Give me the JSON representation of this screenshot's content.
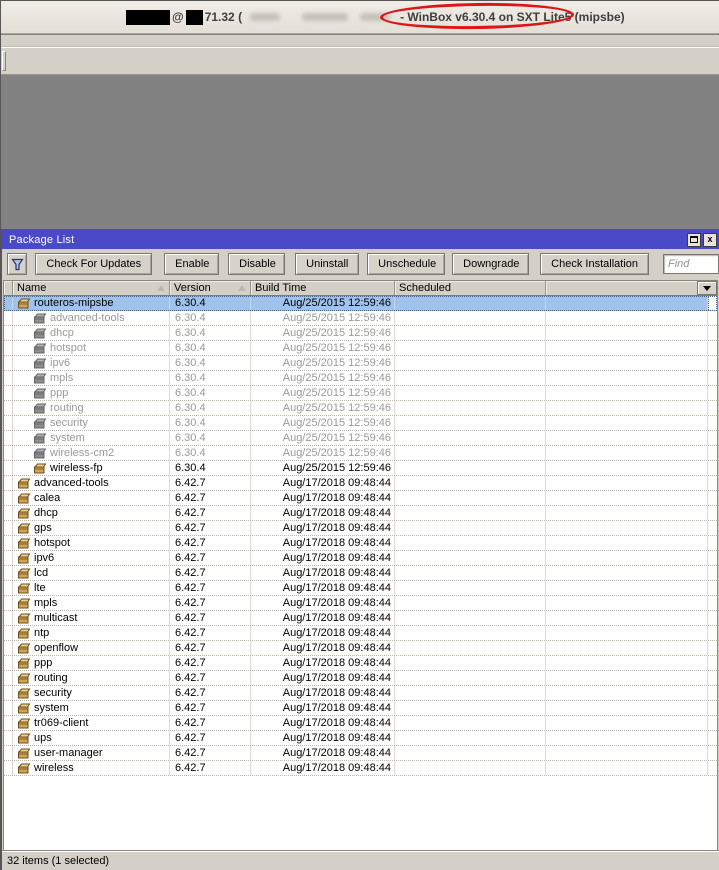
{
  "app": {
    "title_at": "@",
    "title_ip_fragment": "71.32 (",
    "title_winbox": "- WinBox v6.30.4 on SXT Lite5 (mipsbe)"
  },
  "package_list": {
    "title": "Package List",
    "close_glyph": "x",
    "toolbar": {
      "buttons": [
        "Check For Updates",
        "Enable",
        "Disable",
        "Uninstall",
        "Unschedule",
        "Downgrade",
        "Check Installation"
      ],
      "find_placeholder": "Find"
    },
    "columns": {
      "name": "Name",
      "version": "Version",
      "build_time": "Build Time",
      "scheduled": "Scheduled"
    },
    "rows": [
      {
        "name": "routeros-mipsbe",
        "version": "6.30.4",
        "build_time": "Aug/25/2015 12:59:46",
        "scheduled": "",
        "level": 0,
        "state": "selected",
        "icon": "gold"
      },
      {
        "name": "advanced-tools",
        "version": "6.30.4",
        "build_time": "Aug/25/2015 12:59:46",
        "scheduled": "",
        "level": 1,
        "state": "disabled",
        "icon": "gray"
      },
      {
        "name": "dhcp",
        "version": "6.30.4",
        "build_time": "Aug/25/2015 12:59:46",
        "scheduled": "",
        "level": 1,
        "state": "disabled",
        "icon": "gray"
      },
      {
        "name": "hotspot",
        "version": "6.30.4",
        "build_time": "Aug/25/2015 12:59:46",
        "scheduled": "",
        "level": 1,
        "state": "disabled",
        "icon": "gray"
      },
      {
        "name": "ipv6",
        "version": "6.30.4",
        "build_time": "Aug/25/2015 12:59:46",
        "scheduled": "",
        "level": 1,
        "state": "disabled",
        "icon": "gray"
      },
      {
        "name": "mpls",
        "version": "6.30.4",
        "build_time": "Aug/25/2015 12:59:46",
        "scheduled": "",
        "level": 1,
        "state": "disabled",
        "icon": "gray"
      },
      {
        "name": "ppp",
        "version": "6.30.4",
        "build_time": "Aug/25/2015 12:59:46",
        "scheduled": "",
        "level": 1,
        "state": "disabled",
        "icon": "gray"
      },
      {
        "name": "routing",
        "version": "6.30.4",
        "build_time": "Aug/25/2015 12:59:46",
        "scheduled": "",
        "level": 1,
        "state": "disabled",
        "icon": "gray"
      },
      {
        "name": "security",
        "version": "6.30.4",
        "build_time": "Aug/25/2015 12:59:46",
        "scheduled": "",
        "level": 1,
        "state": "disabled",
        "icon": "gray"
      },
      {
        "name": "system",
        "version": "6.30.4",
        "build_time": "Aug/25/2015 12:59:46",
        "scheduled": "",
        "level": 1,
        "state": "disabled",
        "icon": "gray"
      },
      {
        "name": "wireless-cm2",
        "version": "6.30.4",
        "build_time": "Aug/25/2015 12:59:46",
        "scheduled": "",
        "level": 1,
        "state": "disabled",
        "icon": "gray"
      },
      {
        "name": "wireless-fp",
        "version": "6.30.4",
        "build_time": "Aug/25/2015 12:59:46",
        "scheduled": "",
        "level": 1,
        "state": "enabled",
        "icon": "gold"
      },
      {
        "name": "advanced-tools",
        "version": "6.42.7",
        "build_time": "Aug/17/2018 09:48:44",
        "scheduled": "",
        "level": 0,
        "state": "enabled",
        "icon": "gold"
      },
      {
        "name": "calea",
        "version": "6.42.7",
        "build_time": "Aug/17/2018 09:48:44",
        "scheduled": "",
        "level": 0,
        "state": "enabled",
        "icon": "gold"
      },
      {
        "name": "dhcp",
        "version": "6.42.7",
        "build_time": "Aug/17/2018 09:48:44",
        "scheduled": "",
        "level": 0,
        "state": "enabled",
        "icon": "gold"
      },
      {
        "name": "gps",
        "version": "6.42.7",
        "build_time": "Aug/17/2018 09:48:44",
        "scheduled": "",
        "level": 0,
        "state": "enabled",
        "icon": "gold"
      },
      {
        "name": "hotspot",
        "version": "6.42.7",
        "build_time": "Aug/17/2018 09:48:44",
        "scheduled": "",
        "level": 0,
        "state": "enabled",
        "icon": "gold"
      },
      {
        "name": "ipv6",
        "version": "6.42.7",
        "build_time": "Aug/17/2018 09:48:44",
        "scheduled": "",
        "level": 0,
        "state": "enabled",
        "icon": "gold"
      },
      {
        "name": "lcd",
        "version": "6.42.7",
        "build_time": "Aug/17/2018 09:48:44",
        "scheduled": "",
        "level": 0,
        "state": "enabled",
        "icon": "gold"
      },
      {
        "name": "lte",
        "version": "6.42.7",
        "build_time": "Aug/17/2018 09:48:44",
        "scheduled": "",
        "level": 0,
        "state": "enabled",
        "icon": "gold"
      },
      {
        "name": "mpls",
        "version": "6.42.7",
        "build_time": "Aug/17/2018 09:48:44",
        "scheduled": "",
        "level": 0,
        "state": "enabled",
        "icon": "gold"
      },
      {
        "name": "multicast",
        "version": "6.42.7",
        "build_time": "Aug/17/2018 09:48:44",
        "scheduled": "",
        "level": 0,
        "state": "enabled",
        "icon": "gold"
      },
      {
        "name": "ntp",
        "version": "6.42.7",
        "build_time": "Aug/17/2018 09:48:44",
        "scheduled": "",
        "level": 0,
        "state": "enabled",
        "icon": "gold"
      },
      {
        "name": "openflow",
        "version": "6.42.7",
        "build_time": "Aug/17/2018 09:48:44",
        "scheduled": "",
        "level": 0,
        "state": "enabled",
        "icon": "gold"
      },
      {
        "name": "ppp",
        "version": "6.42.7",
        "build_time": "Aug/17/2018 09:48:44",
        "scheduled": "",
        "level": 0,
        "state": "enabled",
        "icon": "gold"
      },
      {
        "name": "routing",
        "version": "6.42.7",
        "build_time": "Aug/17/2018 09:48:44",
        "scheduled": "",
        "level": 0,
        "state": "enabled",
        "icon": "gold"
      },
      {
        "name": "security",
        "version": "6.42.7",
        "build_time": "Aug/17/2018 09:48:44",
        "scheduled": "",
        "level": 0,
        "state": "enabled",
        "icon": "gold"
      },
      {
        "name": "system",
        "version": "6.42.7",
        "build_time": "Aug/17/2018 09:48:44",
        "scheduled": "",
        "level": 0,
        "state": "enabled",
        "icon": "gold"
      },
      {
        "name": "tr069-client",
        "version": "6.42.7",
        "build_time": "Aug/17/2018 09:48:44",
        "scheduled": "",
        "level": 0,
        "state": "enabled",
        "icon": "gold"
      },
      {
        "name": "ups",
        "version": "6.42.7",
        "build_time": "Aug/17/2018 09:48:44",
        "scheduled": "",
        "level": 0,
        "state": "enabled",
        "icon": "gold"
      },
      {
        "name": "user-manager",
        "version": "6.42.7",
        "build_time": "Aug/17/2018 09:48:44",
        "scheduled": "",
        "level": 0,
        "state": "enabled",
        "icon": "gold"
      },
      {
        "name": "wireless",
        "version": "6.42.7",
        "build_time": "Aug/17/2018 09:48:44",
        "scheduled": "",
        "level": 0,
        "state": "enabled",
        "icon": "gold"
      }
    ],
    "status": "32 items (1 selected)"
  },
  "colors": {
    "titlebar_blue": "#4a4ac9",
    "selection_blue": "#9fc3ec",
    "chrome_tan": "#d4d0c8",
    "workspace_gray": "#828282",
    "annotation_red": "#dd1515"
  }
}
